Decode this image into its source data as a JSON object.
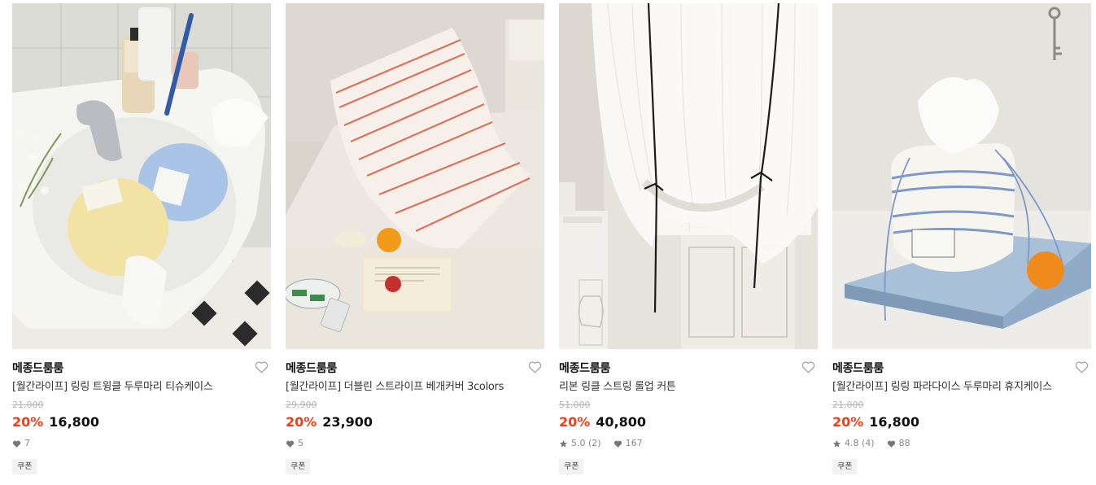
{
  "colors": {
    "accent": "#fa3c0f",
    "text": "#111111",
    "muted": "#888888",
    "strike": "#b5b5b5",
    "tag_bg": "#f2f2f2"
  },
  "icons": {
    "wish": "heart-outline-icon",
    "likes": "heart-filled-icon",
    "rating": "star-icon"
  },
  "products": [
    {
      "image": "pastel drawstring tissue pouches in a bathroom sink",
      "brand": "메종드룸룸",
      "name": "[월간라이프] 링링 트윙클 두루마리 티슈케이스",
      "original_price": "21,000",
      "discount": "20%",
      "price": "16,800",
      "rating": "",
      "likes": "7",
      "tag": "쿠폰"
    },
    {
      "image": "red striped pillow on a cream bed with a book and an orange",
      "brand": "메종드룸룸",
      "name": "[월간라이프] 더블린 스트라이프 베개커버 3colors",
      "original_price": "29,900",
      "discount": "20%",
      "price": "23,900",
      "rating": "",
      "likes": "5",
      "tag": "쿠폰"
    },
    {
      "image": "sheer white roll-up curtain tied with black ribbons",
      "brand": "메종드룸룸",
      "name": "리본 링클 스트링 롤업 커튼",
      "original_price": "51,000",
      "discount": "20%",
      "price": "40,800",
      "rating": "5.0 (2)",
      "likes": "167",
      "tag": "쿠폰"
    },
    {
      "image": "blue striped drawstring tissue case on a blue book with an orange",
      "brand": "메종드룸룸",
      "name": "[월간라이프] 링링 파라다이스 두루마리 휴지케이스",
      "original_price": "21,000",
      "discount": "20%",
      "price": "16,800",
      "rating": "4.8 (4)",
      "likes": "88",
      "tag": "쿠폰"
    }
  ]
}
